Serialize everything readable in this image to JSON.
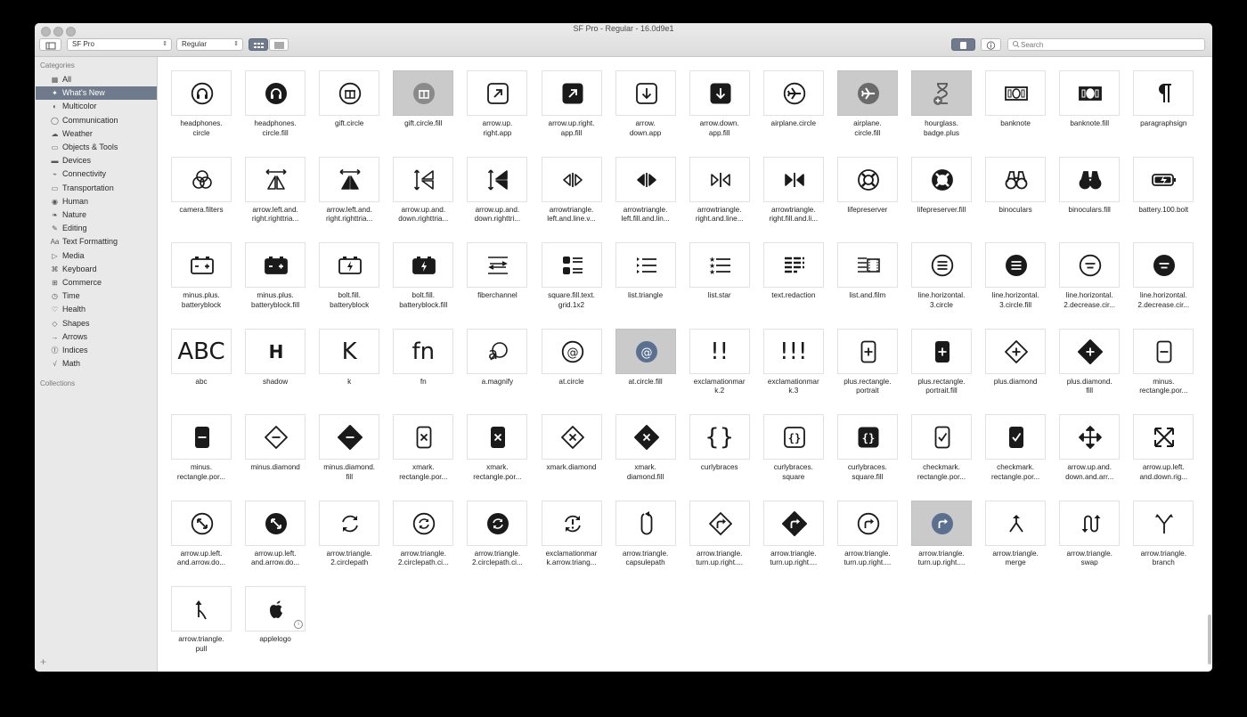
{
  "window": {
    "title": "SF Pro - Regular - 16.0d9e1"
  },
  "toolbar": {
    "font_family": "SF Pro",
    "font_weight": "Regular",
    "search_placeholder": "Search"
  },
  "sidebar": {
    "categories_label": "Categories",
    "collections_label": "Collections",
    "items": [
      {
        "label": "All",
        "icon": "grid-icon"
      },
      {
        "label": "What's New",
        "icon": "sparkle-icon",
        "active": true
      },
      {
        "label": "Multicolor",
        "icon": "multicolor-icon"
      },
      {
        "label": "Communication",
        "icon": "bubble-icon"
      },
      {
        "label": "Weather",
        "icon": "cloud-icon"
      },
      {
        "label": "Objects & Tools",
        "icon": "folder-icon"
      },
      {
        "label": "Devices",
        "icon": "display-icon"
      },
      {
        "label": "Connectivity",
        "icon": "antenna-icon"
      },
      {
        "label": "Transportation",
        "icon": "car-icon"
      },
      {
        "label": "Human",
        "icon": "person-icon"
      },
      {
        "label": "Nature",
        "icon": "leaf-icon"
      },
      {
        "label": "Editing",
        "icon": "pencil-icon"
      },
      {
        "label": "Text Formatting",
        "icon": "textformat-icon"
      },
      {
        "label": "Media",
        "icon": "play-icon"
      },
      {
        "label": "Keyboard",
        "icon": "command-icon"
      },
      {
        "label": "Commerce",
        "icon": "cart-icon"
      },
      {
        "label": "Time",
        "icon": "clock-icon"
      },
      {
        "label": "Health",
        "icon": "heart-icon"
      },
      {
        "label": "Shapes",
        "icon": "shapes-icon"
      },
      {
        "label": "Arrows",
        "icon": "arrow-icon"
      },
      {
        "label": "Indices",
        "icon": "index-icon"
      },
      {
        "label": "Math",
        "icon": "sqrt-icon"
      }
    ]
  },
  "symbols": [
    {
      "name": "headphones.\ncircle",
      "g": "headphones"
    },
    {
      "name": "headphones.\ncircle.fill",
      "g": "headphones-fill"
    },
    {
      "name": "gift.circle",
      "g": "gift"
    },
    {
      "name": "gift.circle.fill",
      "g": "gift-fill",
      "selected": true
    },
    {
      "name": "arrow.up.\nright.app",
      "g": "arrow-app"
    },
    {
      "name": "arrow.up.right.\napp.fill",
      "g": "arrow-app-fill"
    },
    {
      "name": "arrow.\ndown.app",
      "g": "down-app"
    },
    {
      "name": "arrow.down.\napp.fill",
      "g": "down-app-fill"
    },
    {
      "name": "airplane.circle",
      "g": "airplane"
    },
    {
      "name": "airplane.\ncircle.fill",
      "g": "airplane-fill",
      "selected": true
    },
    {
      "name": "hourglass.\nbadge.plus",
      "g": "hourglass",
      "selected": true
    },
    {
      "name": "banknote",
      "g": "banknote"
    },
    {
      "name": "banknote.fill",
      "g": "banknote-fill"
    },
    {
      "name": "paragraphsign",
      "g": "paragraph"
    },
    {
      "name": "camera.filters",
      "g": "filters"
    },
    {
      "name": "arrow.left.and.\nright.righttria...",
      "g": "lr-tri"
    },
    {
      "name": "arrow.left.and.\nright.righttria...",
      "g": "lr-tri-fill"
    },
    {
      "name": "arrow.up.and.\ndown.righttria...",
      "g": "ud-tri"
    },
    {
      "name": "arrow.up.and.\ndown.righttri...",
      "g": "ud-tri-fill"
    },
    {
      "name": "arrowtriangle.\nleft.and.line.v...",
      "g": "tri-lr"
    },
    {
      "name": "arrowtriangle.\nleft.fill.and.lin...",
      "g": "tri-lr-fill"
    },
    {
      "name": "arrowtriangle.\nright.and.line...",
      "g": "tri-rl"
    },
    {
      "name": "arrowtriangle.\nright.fill.and.li...",
      "g": "tri-rl-fill"
    },
    {
      "name": "lifepreserver",
      "g": "life"
    },
    {
      "name": "lifepreserver.fill",
      "g": "life-fill"
    },
    {
      "name": "binoculars",
      "g": "binoculars"
    },
    {
      "name": "binoculars.fill",
      "g": "binoculars-fill"
    },
    {
      "name": "battery.100.bolt",
      "g": "battery"
    },
    {
      "name": "minus.plus.\nbatteryblock",
      "g": "batteryblock"
    },
    {
      "name": "minus.plus.\nbatteryblock.fill",
      "g": "batteryblock-fill"
    },
    {
      "name": "bolt.fill.\nbatteryblock",
      "g": "bolt-block"
    },
    {
      "name": "bolt.fill.\nbatteryblock.fill",
      "g": "bolt-block-fill"
    },
    {
      "name": "fiberchannel",
      "g": "fiber"
    },
    {
      "name": "square.fill.text.\ngrid.1x2",
      "g": "textgrid"
    },
    {
      "name": "list.triangle",
      "g": "list-tri"
    },
    {
      "name": "list.star",
      "g": "list-star"
    },
    {
      "name": "text.redaction",
      "g": "redaction"
    },
    {
      "name": "list.and.film",
      "g": "list-film"
    },
    {
      "name": "line.horizontal.\n3.circle",
      "g": "lines3"
    },
    {
      "name": "line.horizontal.\n3.circle.fill",
      "g": "lines3-fill"
    },
    {
      "name": "line.horizontal.\n2.decrease.cir...",
      "g": "lines2"
    },
    {
      "name": "line.horizontal.\n2.decrease.cir...",
      "g": "lines2-fill"
    },
    {
      "name": "abc",
      "g": "text",
      "text": "ABC"
    },
    {
      "name": "shadow",
      "g": "shadow"
    },
    {
      "name": "k",
      "g": "text",
      "text": "K"
    },
    {
      "name": "fn",
      "g": "text",
      "text": "fn"
    },
    {
      "name": "a.magnify",
      "g": "amagnify"
    },
    {
      "name": "at.circle",
      "g": "at"
    },
    {
      "name": "at.circle.fill",
      "g": "at-fill",
      "selected": true
    },
    {
      "name": "exclamationmar\nk.2",
      "g": "text",
      "text": "!!"
    },
    {
      "name": "exclamationmar\nk.3",
      "g": "text",
      "text": "!!!"
    },
    {
      "name": "plus.rectangle.\nportrait",
      "g": "plus-rect"
    },
    {
      "name": "plus.rectangle.\nportrait.fill",
      "g": "plus-rect-fill"
    },
    {
      "name": "plus.diamond",
      "g": "plus-dia"
    },
    {
      "name": "plus.diamond.\nfill",
      "g": "plus-dia-fill"
    },
    {
      "name": "minus.\nrectangle.por...",
      "g": "minus-rect"
    },
    {
      "name": "minus.\nrectangle.por...",
      "g": "minus-rect-fill"
    },
    {
      "name": "minus.diamond",
      "g": "minus-dia"
    },
    {
      "name": "minus.diamond.\nfill",
      "g": "minus-dia-fill"
    },
    {
      "name": "xmark.\nrectangle.por...",
      "g": "x-rect"
    },
    {
      "name": "xmark.\nrectangle.por...",
      "g": "x-rect-fill"
    },
    {
      "name": "xmark.diamond",
      "g": "x-dia"
    },
    {
      "name": "xmark.\ndiamond.fill",
      "g": "x-dia-fill"
    },
    {
      "name": "curlybraces",
      "g": "text",
      "text": "{}"
    },
    {
      "name": "curlybraces.\nsquare",
      "g": "curly-sq"
    },
    {
      "name": "curlybraces.\nsquare.fill",
      "g": "curly-sq-fill"
    },
    {
      "name": "checkmark.\nrectangle.por...",
      "g": "check-rect"
    },
    {
      "name": "checkmark.\nrectangle.por...",
      "g": "check-rect-fill"
    },
    {
      "name": "arrow.up.and.\ndown.and.arr...",
      "g": "move"
    },
    {
      "name": "arrow.up.left.\nand.down.rig...",
      "g": "expand"
    },
    {
      "name": "arrow.up.left.\nand.arrow.do...",
      "g": "diag"
    },
    {
      "name": "arrow.up.left.\nand.arrow.do...",
      "g": "diag-fill"
    },
    {
      "name": "arrow.triangle.\n2.circlepath",
      "g": "cycle"
    },
    {
      "name": "arrow.triangle.\n2.circlepath.ci...",
      "g": "cycle-circle"
    },
    {
      "name": "arrow.triangle.\n2.circlepath.ci...",
      "g": "cycle-circle-fill"
    },
    {
      "name": "exclamationmar\nk.arrow.triang...",
      "g": "excl-cycle"
    },
    {
      "name": "arrow.triangle.\ncapsulepath",
      "g": "capsule"
    },
    {
      "name": "arrow.triangle.\nturn.up.right....",
      "g": "turn-dia"
    },
    {
      "name": "arrow.triangle.\nturn.up.right....",
      "g": "turn-dia-fill"
    },
    {
      "name": "arrow.triangle.\nturn.up.right....",
      "g": "turn-circle"
    },
    {
      "name": "arrow.triangle.\nturn.up.right....",
      "g": "turn-circle-fill",
      "selected": true
    },
    {
      "name": "arrow.triangle.\nmerge",
      "g": "merge"
    },
    {
      "name": "arrow.triangle.\nswap",
      "g": "swap"
    },
    {
      "name": "arrow.triangle.\nbranch",
      "g": "branch"
    },
    {
      "name": "arrow.triangle.\npull",
      "g": "pull"
    },
    {
      "name": "applelogo",
      "g": "apple",
      "info": true
    }
  ]
}
